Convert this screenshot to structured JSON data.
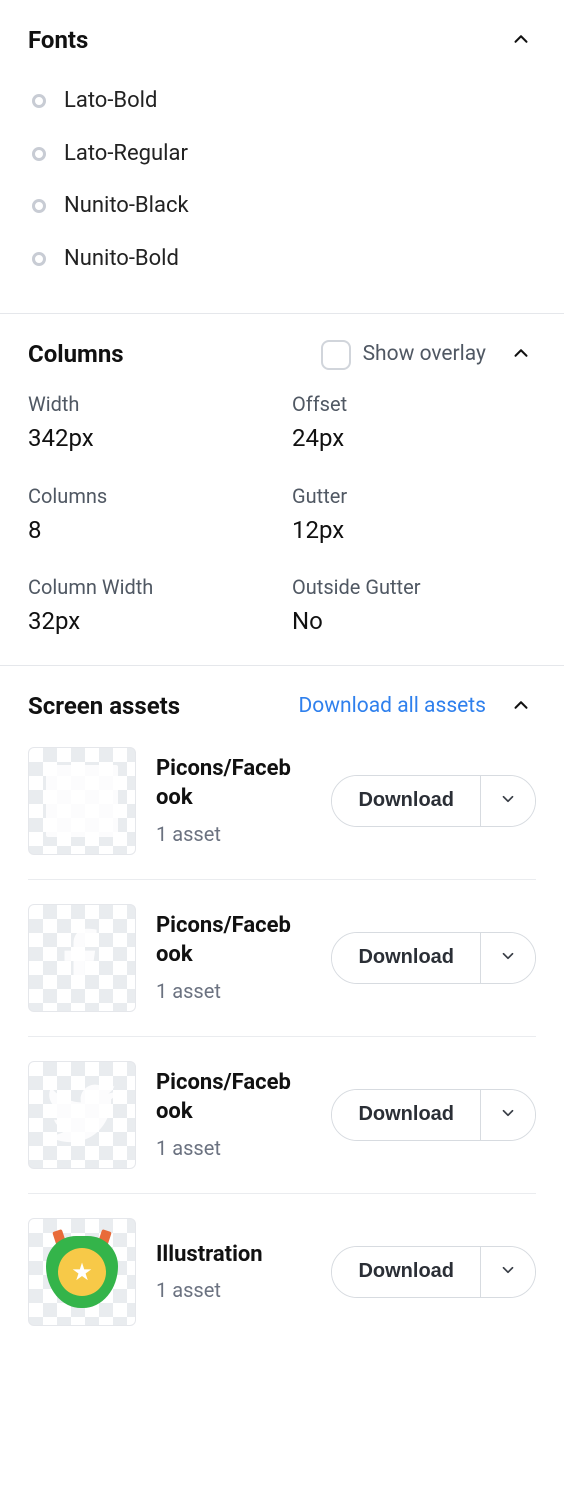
{
  "fonts": {
    "title": "Fonts",
    "items": [
      {
        "name": "Lato-Bold"
      },
      {
        "name": "Lato-Regular"
      },
      {
        "name": "Nunito-Black"
      },
      {
        "name": "Nunito-Bold"
      }
    ]
  },
  "columns": {
    "title": "Columns",
    "overlay_label": "Show overlay",
    "metrics": {
      "width": {
        "label": "Width",
        "value": "342px"
      },
      "offset": {
        "label": "Offset",
        "value": "24px"
      },
      "columns": {
        "label": "Columns",
        "value": "8"
      },
      "gutter": {
        "label": "Gutter",
        "value": "12px"
      },
      "column_width": {
        "label": "Column Width",
        "value": "32px"
      },
      "outside_gutter": {
        "label": "Outside Gutter",
        "value": "No"
      }
    }
  },
  "assets": {
    "title": "Screen assets",
    "download_all_label": "Download all assets",
    "download_label": "Download",
    "items": [
      {
        "name": "Picons/Facebook",
        "count_label": "1 asset",
        "thumb_kind": "blank"
      },
      {
        "name": "Picons/Facebook",
        "count_label": "1 asset",
        "thumb_kind": "fb-f"
      },
      {
        "name": "Picons/Facebook",
        "count_label": "1 asset",
        "thumb_kind": "bird"
      },
      {
        "name": "Illustration",
        "count_label": "1 asset",
        "thumb_kind": "badge"
      }
    ]
  }
}
